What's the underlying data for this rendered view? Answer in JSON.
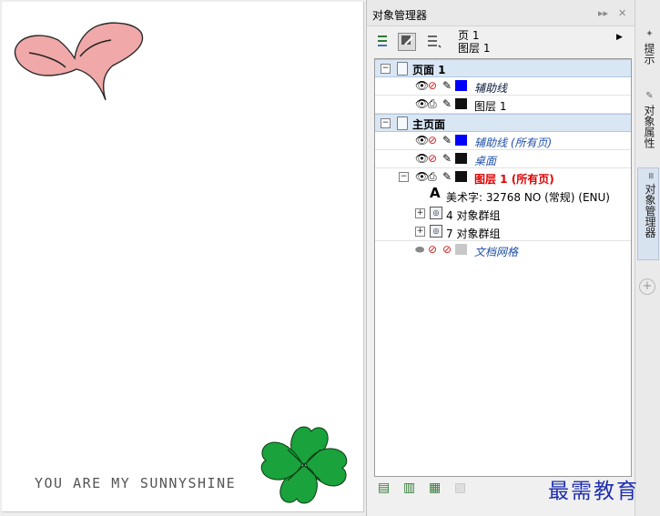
{
  "canvas": {
    "slogan": "YOU ARE MY SUNNYSHINE",
    "heart_color": "#f0a8a8",
    "clover_color": "#1aa23c"
  },
  "docker": {
    "title": "对象管理器",
    "current_page": "页 1",
    "current_layer": "图层 1",
    "toolbar_icons": [
      "show-object-properties-icon",
      "edit-across-layers-icon",
      "layer-manager-view-icon"
    ],
    "tree": {
      "page1": {
        "label": "页面 1",
        "layers": [
          {
            "label": "辅助线",
            "color": "#0000ff"
          },
          {
            "label": "图层 1",
            "color": "#111111"
          }
        ]
      },
      "master": {
        "label": "主页面",
        "layers": [
          {
            "label": "辅助线 (所有页)",
            "color": "#0000ff"
          },
          {
            "label": "桌面",
            "color": "#111111"
          },
          {
            "label": "图层 1 (所有页)",
            "color": "#111111"
          }
        ],
        "objects": [
          {
            "label": "美术字: 32768 NO (常规) (ENU)"
          },
          {
            "label": "4 对象群组"
          },
          {
            "label": "7 对象群组"
          }
        ],
        "grid": {
          "label": "文档网格",
          "color": "#c8c8c8"
        }
      }
    },
    "bottom_icons": [
      "new-layer-icon",
      "new-master-layer-icon",
      "new-master-layer-all-icon",
      "delete-icon"
    ]
  },
  "side_tabs": [
    {
      "label": "提示",
      "icon": "hint-icon"
    },
    {
      "label": "对象属性",
      "icon": "properties-icon"
    },
    {
      "label": "对象管理器",
      "icon": "object-manager-icon"
    }
  ],
  "watermark": "最需教育"
}
